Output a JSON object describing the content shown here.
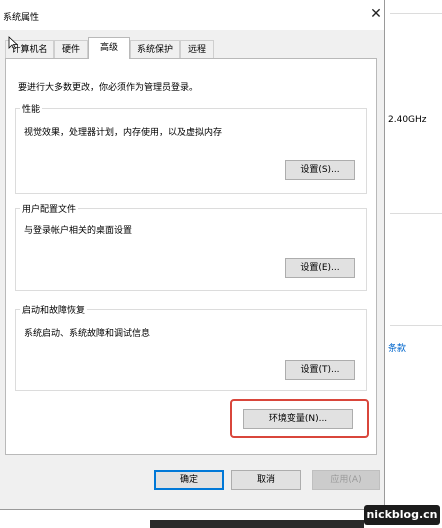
{
  "window": {
    "title": "系统属性"
  },
  "tabs": [
    {
      "label": "计算机名"
    },
    {
      "label": "硬件"
    },
    {
      "label": "高级"
    },
    {
      "label": "系统保护"
    },
    {
      "label": "远程"
    }
  ],
  "admin_note": "要进行大多数更改，你必须作为管理员登录。",
  "performance": {
    "label": "性能",
    "description": "视觉效果，处理器计划，内存使用，以及虚拟内存",
    "button": "设置(S)..."
  },
  "user_profiles": {
    "label": "用户配置文件",
    "description": "与登录帐户相关的桌面设置",
    "button": "设置(E)..."
  },
  "startup_recovery": {
    "label": "启动和故障恢复",
    "description": "系统启动、系统故障和调试信息",
    "button": "设置(T)..."
  },
  "env_button": "环境变量(N)...",
  "footer": {
    "ok": "确定",
    "cancel": "取消",
    "apply": "应用(A)"
  },
  "background": {
    "cpu_speed": "2.40GHz",
    "link_fragment": "条款"
  },
  "watermark": "nickblog.cn",
  "colors": {
    "highlight": "#d9463b",
    "accent": "#0078d7",
    "link": "#0066cc"
  }
}
